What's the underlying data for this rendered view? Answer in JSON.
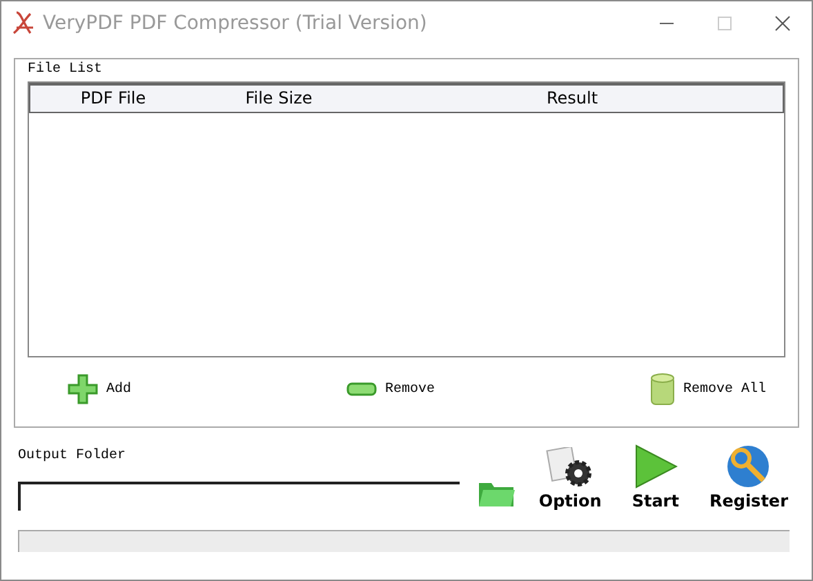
{
  "window": {
    "title": "VeryPDF PDF Compressor (Trial Version)"
  },
  "file_list": {
    "title": "File List",
    "columns": [
      "PDF File",
      "File Size",
      "Result"
    ]
  },
  "list_buttons": [
    {
      "kind": "add",
      "label": "Add"
    },
    {
      "kind": "remove",
      "label": "Remove"
    },
    {
      "kind": "remove_all",
      "label": "Remove All"
    }
  ],
  "output": {
    "label": "Output Folder"
  },
  "actions": [
    {
      "kind": "option",
      "label": "Option"
    },
    {
      "kind": "start",
      "label": "Start"
    },
    {
      "kind": "register",
      "label": "Register"
    }
  ]
}
